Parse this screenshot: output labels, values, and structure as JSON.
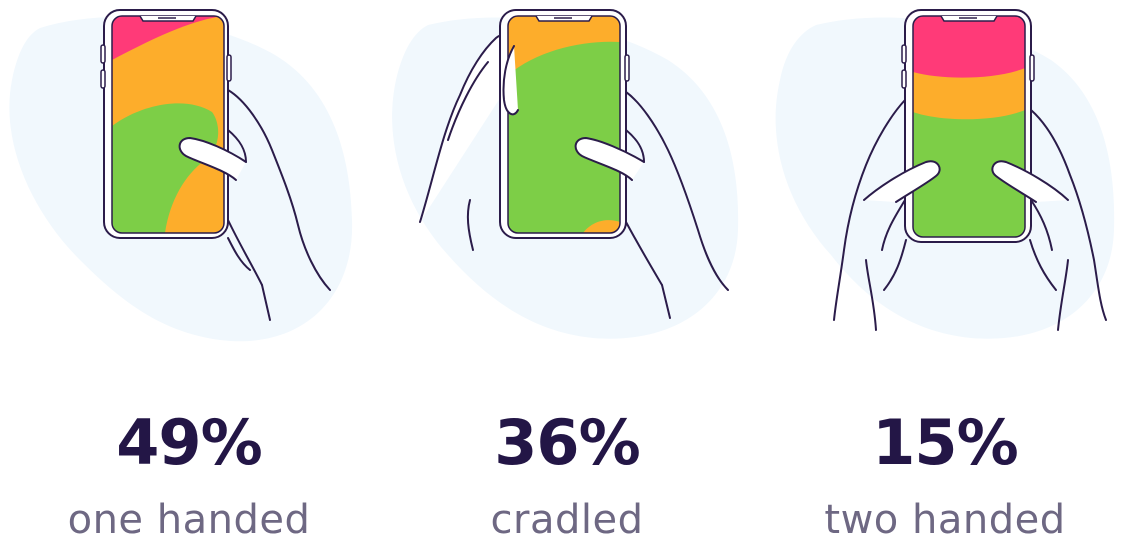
{
  "colors": {
    "blob": "#f1f8fd",
    "outline": "#2b1c4a",
    "green": "#7dce47",
    "orange": "#fdad2b",
    "pink": "#ff3a78",
    "percent_text": "#231646",
    "label_text": "#6e6883"
  },
  "stats": [
    {
      "percent": "49%",
      "label": "one handed"
    },
    {
      "percent": "36%",
      "label": "cradled"
    },
    {
      "percent": "15%",
      "label": "two handed"
    }
  ]
}
